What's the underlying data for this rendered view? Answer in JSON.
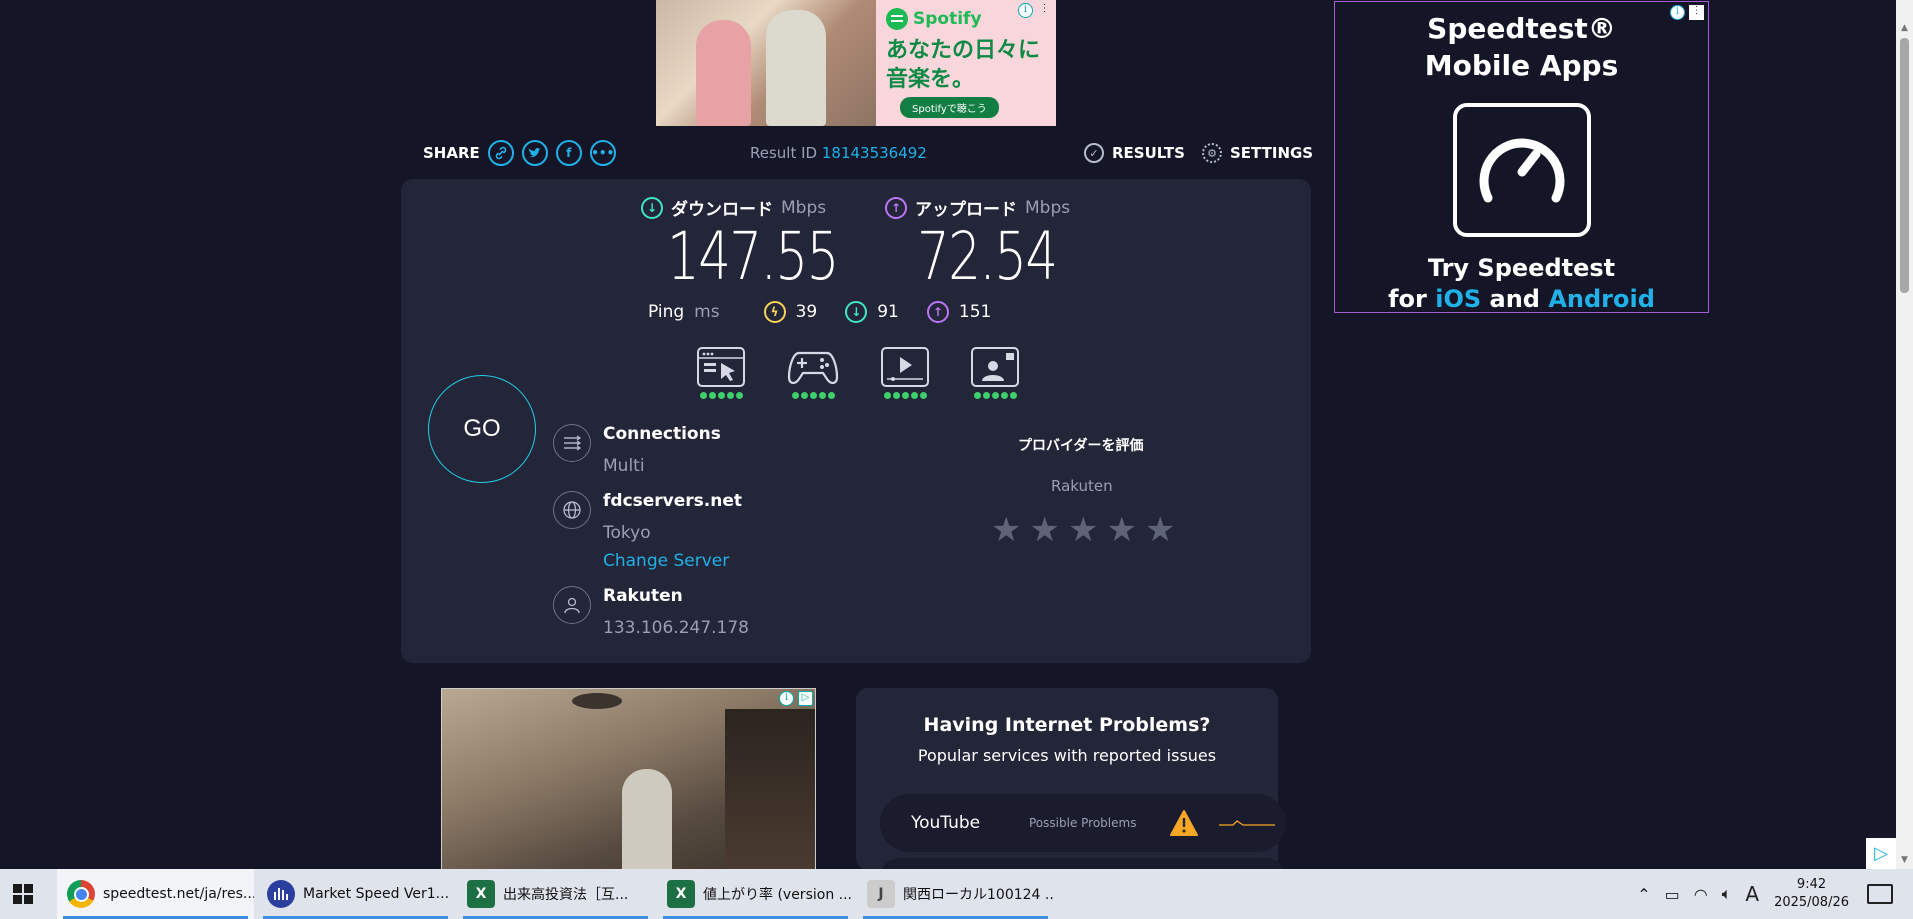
{
  "ads": {
    "top": {
      "brand": "Spotify",
      "headline_line1": "あなたの日々に",
      "headline_line2": "音楽を。",
      "button": "Spotifyで聴こう"
    },
    "right": {
      "headline_line1": "Speedtest®",
      "headline_line2": "Mobile Apps",
      "tag_line1": "Try Speedtest",
      "tag_for": "for",
      "tag_ios": "iOS",
      "tag_and": "and",
      "tag_android": "Android"
    }
  },
  "share": {
    "label": "SHARE",
    "icons": [
      "link-icon",
      "twitter-icon",
      "facebook-icon",
      "more-icon"
    ],
    "result_id_label": "Result ID",
    "result_id": "18143536492",
    "results_label": "RESULTS",
    "settings_label": "SETTINGS"
  },
  "test": {
    "download": {
      "label": "ダウンロード",
      "unit": "Mbps",
      "value": "147.55"
    },
    "upload": {
      "label": "アップロード",
      "unit": "Mbps",
      "value": "72.54"
    },
    "ping": {
      "label": "Ping",
      "unit": "ms",
      "idle": "39",
      "download": "91",
      "upload": "151"
    },
    "performance": [
      {
        "name": "web-browsing-icon",
        "rating": 5
      },
      {
        "name": "gaming-icon",
        "rating": 5
      },
      {
        "name": "video-streaming-icon",
        "rating": 5
      },
      {
        "name": "video-chat-icon",
        "rating": 5
      }
    ],
    "go_label": "GO",
    "connections": {
      "title": "Connections",
      "value": "Multi"
    },
    "server": {
      "title": "fdcservers.net",
      "location": "Tokyo",
      "change_label": "Change Server"
    },
    "isp": {
      "title": "Rakuten",
      "ip": "133.106.247.178"
    },
    "rate": {
      "title": "プロバイダーを評価",
      "isp": "Rakuten",
      "stars": 5
    }
  },
  "problems": {
    "title": "Having Internet Problems?",
    "subtitle": "Popular services with reported issues",
    "items": [
      {
        "name": "YouTube",
        "status": "Possible Problems"
      }
    ]
  },
  "taskbar": {
    "items": [
      {
        "label": "speedtest.net/ja/res...",
        "icon": "chrome-icon"
      },
      {
        "label": "Market Speed Ver1...",
        "icon": "market-speed-icon"
      },
      {
        "label": "出来高投資法［互...",
        "icon": "excel-icon"
      },
      {
        "label": "値上がり率 (version ...",
        "icon": "excel-icon"
      },
      {
        "label": "関西ローカル100124 ...",
        "icon": "java-icon"
      }
    ],
    "ime": "A",
    "time": "9:42",
    "date": "2025/08/26"
  },
  "colors": {
    "background": "#141526",
    "card": "#232539",
    "accent": "#1fb1e8",
    "download": "#41e5c7",
    "upload": "#ba75f4",
    "jitter": "#f5d25b",
    "good": "#3ed06b"
  }
}
